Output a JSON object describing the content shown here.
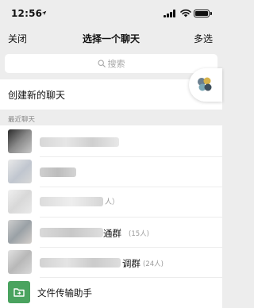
{
  "status": {
    "time": "12:56",
    "location_icon": "location-arrow-icon"
  },
  "nav": {
    "close": "关闭",
    "title": "选择一个聊天",
    "multi": "多选"
  },
  "search": {
    "placeholder": "搜索"
  },
  "create_chat": {
    "label": "创建新的聊天"
  },
  "section": {
    "recent_label": "最近聊天"
  },
  "chats": [
    {
      "name": "",
      "count": ""
    },
    {
      "name": "",
      "count": ""
    },
    {
      "name": "",
      "count": ""
    },
    {
      "name": "",
      "count": ""
    },
    {
      "name": "",
      "count": ""
    }
  ],
  "partial": {
    "row3_suffix": "人）",
    "row4_name_tail": "通群",
    "row4_count": "(15人)",
    "row5_name_tail": "调群",
    "row5_count": "(24人)"
  },
  "file_helper": {
    "label": "文件传输助手"
  },
  "colors": {
    "background": "#ededed",
    "accent_green": "#4aa35f"
  }
}
